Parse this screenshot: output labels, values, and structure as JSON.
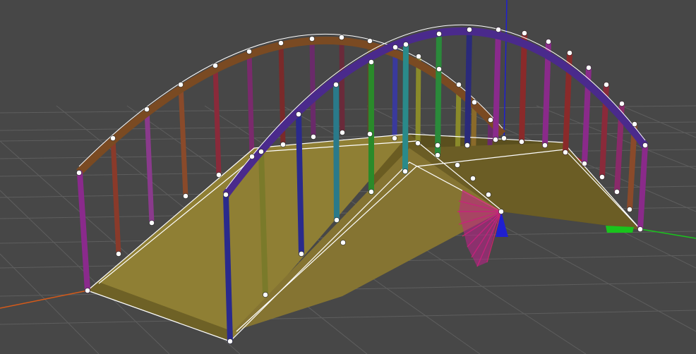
{
  "viewport": {
    "background": "#474747",
    "grid_color": "#5c5c5c",
    "deck_color": "#8f7f34",
    "deck_shadow_color": "#5a4f1e",
    "outline_color": "#ffffff",
    "axis_colors": {
      "x": "#d7262a",
      "y": "#19c41c",
      "z": "#1f1fd0"
    }
  },
  "gizmo": {
    "name": "rotation-gizmo",
    "colors": [
      "#d1246a",
      "#a81abf",
      "#e01a4f"
    ]
  }
}
